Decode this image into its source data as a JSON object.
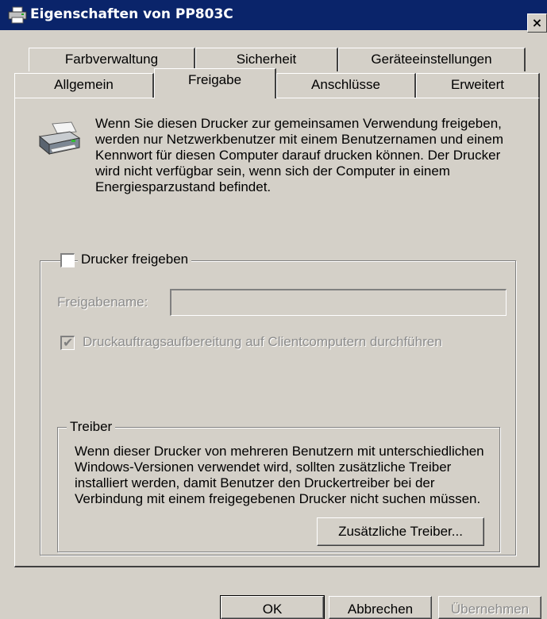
{
  "window": {
    "title": "Eigenschaften von PP803C",
    "close_label": "×"
  },
  "tabs": {
    "row1": [
      {
        "label": "Farbverwaltung"
      },
      {
        "label": "Sicherheit"
      },
      {
        "label": "Geräteeinstellungen"
      }
    ],
    "row2": [
      {
        "label": "Allgemein"
      },
      {
        "label": "Freigabe",
        "active": true
      },
      {
        "label": "Anschlüsse"
      },
      {
        "label": "Erweitert"
      }
    ]
  },
  "sharing": {
    "intro_text": "Wenn Sie diesen Drucker zur gemeinsamen Verwendung freigeben, werden nur Netzwerkbenutzer mit einem Benutzernamen und einem Kennwort für diesen Computer darauf drucken können. Der Drucker wird nicht verfügbar sein, wenn sich der Computer in einem Energiesparzustand befindet.",
    "share_checkbox_label": "Drucker freigeben",
    "share_checked": false,
    "share_name_label": "Freigabename:",
    "share_name_value": "",
    "render_jobs_label": "Druckauftragsaufbereitung auf Clientcomputern durchführen",
    "render_jobs_checked": true
  },
  "drivers": {
    "group_label": "Treiber",
    "text": "Wenn dieser Drucker von mehreren Benutzern mit unterschiedlichen Windows-Versionen verwendet wird, sollten zusätzliche Treiber installiert werden, damit Benutzer den Druckertreiber bei der Verbindung mit einem freigegebenen Drucker nicht suchen müssen.",
    "button_label": "Zusätzliche Treiber..."
  },
  "footer": {
    "ok_label": "OK",
    "cancel_label": "Abbrechen",
    "apply_label": "Übernehmen"
  },
  "colors": {
    "titlebar": "#0a246a",
    "dialog_bg": "#d4d0c8",
    "disabled_text": "#8c8c8c"
  }
}
